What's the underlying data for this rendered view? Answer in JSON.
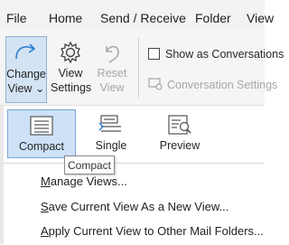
{
  "tabs": [
    "File",
    "Home",
    "Send / Receive",
    "Folder",
    "View"
  ],
  "ribbon": {
    "change_view": {
      "line1": "Change",
      "line2": "View",
      "caret": "⌄"
    },
    "view_settings": {
      "line1": "View",
      "line2": "Settings"
    },
    "reset_view": {
      "line1": "Reset",
      "line2": "View"
    },
    "show_as_conversations": "Show as Conversations",
    "conversation_settings": "Conversation Settings"
  },
  "gallery": [
    {
      "label": "Compact",
      "selected": true
    },
    {
      "label": "Single",
      "selected": false
    },
    {
      "label": "Preview",
      "selected": false
    }
  ],
  "tooltip": "Compact",
  "menu": {
    "manage_views": {
      "key": "M",
      "rest": "anage Views..."
    },
    "save_view": {
      "key": "S",
      "rest": "ave Current View As a New View..."
    },
    "apply_view": {
      "key": "A",
      "rest": "pply Current View to Other Mail Folders..."
    }
  },
  "colors": {
    "accent": "#0f6cbd",
    "selected_bg": "#cde1f7",
    "selected_border": "#79a7d6"
  },
  "icons": [
    "change-view-icon",
    "gear-icon",
    "reset-view-icon",
    "conversation-settings-icon",
    "compact-view-icon",
    "single-view-icon",
    "preview-view-icon"
  ]
}
